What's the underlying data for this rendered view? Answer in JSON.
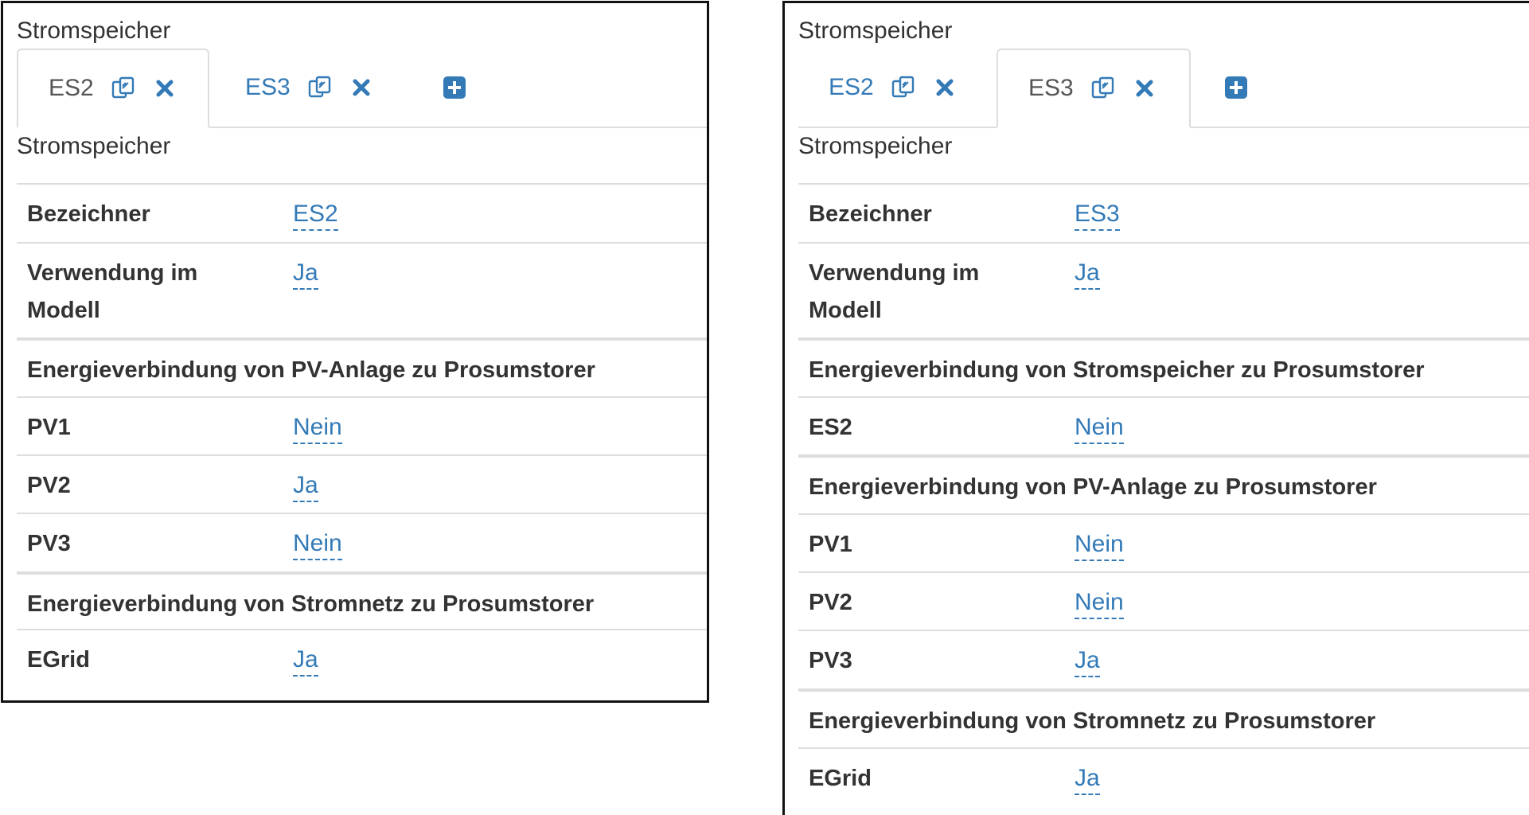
{
  "colors": {
    "link": "#337ab7",
    "border": "#dddddd",
    "text": "#333333"
  },
  "left": {
    "title": "Stromspeicher",
    "tabs": [
      {
        "label": "ES2",
        "active": true
      },
      {
        "label": "ES3",
        "active": false
      }
    ],
    "subtitle": "Stromspeicher",
    "rows": {
      "bezeichner": {
        "label": "Bezeichner",
        "value": "ES2"
      },
      "verwendung": {
        "label": "Verwendung im Modell",
        "value": "Ja"
      },
      "group_pv": "Energieverbindung von PV-Anlage zu Prosumstorer",
      "pv1": {
        "label": "PV1",
        "value": "Nein"
      },
      "pv2": {
        "label": "PV2",
        "value": "Ja"
      },
      "pv3": {
        "label": "PV3",
        "value": "Nein"
      },
      "group_grid": "Energieverbindung von Stromnetz zu Prosumstorer",
      "egrid": {
        "label": "EGrid",
        "value": "Ja"
      }
    }
  },
  "right": {
    "title": "Stromspeicher",
    "tabs": [
      {
        "label": "ES2",
        "active": false
      },
      {
        "label": "ES3",
        "active": true
      }
    ],
    "subtitle": "Stromspeicher",
    "rows": {
      "bezeichner": {
        "label": "Bezeichner",
        "value": "ES3"
      },
      "verwendung": {
        "label": "Verwendung im Modell",
        "value": "Ja"
      },
      "group_storage": "Energieverbindung von Stromspeicher zu Prosumstorer",
      "es2": {
        "label": "ES2",
        "value": "Nein"
      },
      "group_pv": "Energieverbindung von PV-Anlage zu Prosumstorer",
      "pv1": {
        "label": "PV1",
        "value": "Nein"
      },
      "pv2": {
        "label": "PV2",
        "value": "Nein"
      },
      "pv3": {
        "label": "PV3",
        "value": "Ja"
      },
      "group_grid": "Energieverbindung von Stromnetz zu Prosumstorer",
      "egrid": {
        "label": "EGrid",
        "value": "Ja"
      }
    }
  },
  "icons": {
    "copy": "copy-icon",
    "close": "close-icon",
    "add": "plus-square-icon"
  }
}
